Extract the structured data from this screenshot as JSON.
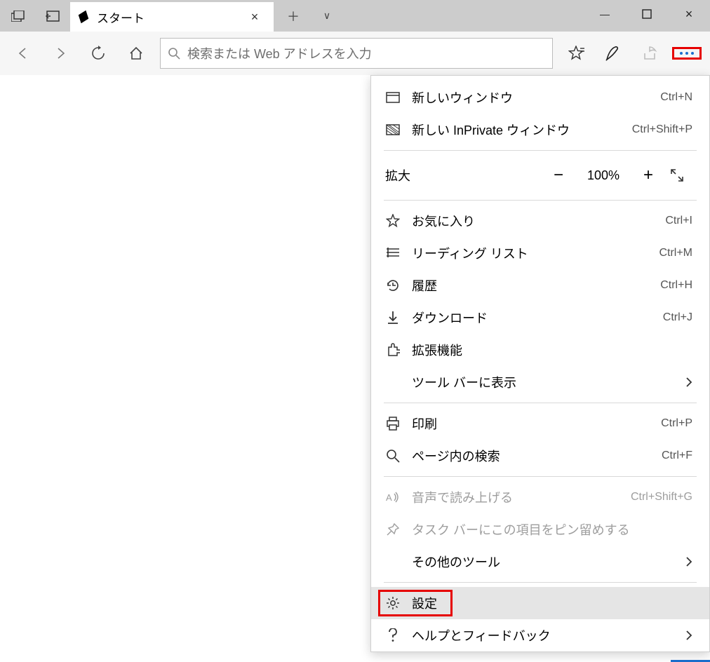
{
  "titlebar": {
    "tab_title": "スタート",
    "tab_close": "×",
    "new_tab_plus": "＋",
    "new_tab_chevron": "∨"
  },
  "window_controls": {
    "minimize": "—",
    "maximize": "□",
    "close": "×"
  },
  "nav": {
    "search_placeholder": "検索または Web アドレスを入力"
  },
  "menu": {
    "new_window": {
      "label": "新しいウィンドウ",
      "shortcut": "Ctrl+N"
    },
    "new_inprivate": {
      "label": "新しい InPrivate ウィンドウ",
      "shortcut": "Ctrl+Shift+P"
    },
    "zoom": {
      "label": "拡大",
      "minus": "−",
      "value": "100%",
      "plus": "+",
      "full": "⤢"
    },
    "favorites": {
      "label": "お気に入り",
      "shortcut": "Ctrl+I"
    },
    "reading_list": {
      "label": "リーディング リスト",
      "shortcut": "Ctrl+M"
    },
    "history": {
      "label": "履歴",
      "shortcut": "Ctrl+H"
    },
    "downloads": {
      "label": "ダウンロード",
      "shortcut": "Ctrl+J"
    },
    "extensions": {
      "label": "拡張機能"
    },
    "show_toolbar": {
      "label": "ツール バーに表示"
    },
    "print": {
      "label": "印刷",
      "shortcut": "Ctrl+P"
    },
    "find": {
      "label": "ページ内の検索",
      "shortcut": "Ctrl+F"
    },
    "read_aloud": {
      "label": "音声で読み上げる",
      "shortcut": "Ctrl+Shift+G"
    },
    "pin_taskbar": {
      "label": "タスク バーにこの項目をピン留めする"
    },
    "other_tools": {
      "label": "その他のツール"
    },
    "settings": {
      "label": "設定"
    },
    "help": {
      "label": "ヘルプとフィードバック"
    }
  }
}
